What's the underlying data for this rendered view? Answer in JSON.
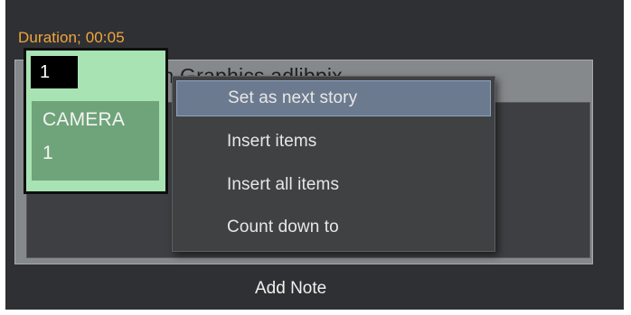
{
  "duration_label": "Duration; 00:05",
  "story": {
    "title": "Cam with Graphics adlibpix",
    "checkbox_color": "#a8e3b3",
    "item": {
      "number": "1",
      "line1": "CAMERA",
      "line2": "1",
      "color": "#a8e3b3"
    },
    "add_note_label": "Add Note"
  },
  "context_menu": {
    "items": [
      {
        "label": "Set as next story",
        "highlighted": true
      },
      {
        "label": "Insert items"
      },
      {
        "label": "Insert all items"
      },
      {
        "label": "Count down to"
      }
    ],
    "highlight_color": "#6c7a8f"
  },
  "colors": {
    "background": "#2f3033",
    "duration_text": "#f0a63e"
  }
}
